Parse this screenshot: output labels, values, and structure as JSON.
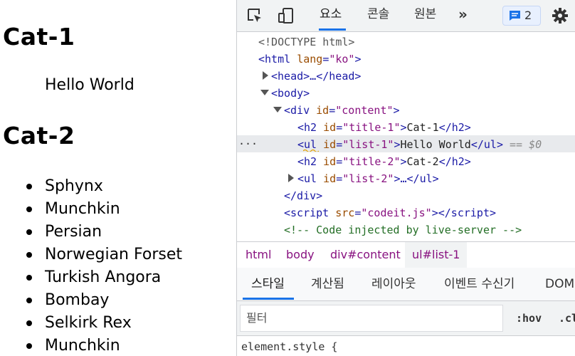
{
  "page": {
    "title1": "Cat-1",
    "hello": "Hello World",
    "title2": "Cat-2",
    "cats": [
      "Sphynx",
      "Munchkin",
      "Persian",
      "Norwegian Forset",
      "Turkish Angora",
      "Bombay",
      "Selkirk Rex",
      "Munchkin"
    ]
  },
  "devtools": {
    "tabs": [
      "요소",
      "콘솔",
      "원본"
    ],
    "more": "»",
    "issues_count": "2",
    "tree": {
      "doctype": "<!DOCTYPE html>",
      "html_open": "<html",
      "html_lang_attr": "lang",
      "html_lang_val": "\"ko\"",
      "head": "<head>…</head>",
      "body": "<body>",
      "div_id": "\"content\"",
      "h2_1_id": "\"title-1\"",
      "h2_1_text": "Cat-1",
      "ul_1_id": "\"list-1\"",
      "ul_1_text": "Hello World",
      "eq": "== $0",
      "h2_2_id": "\"title-2\"",
      "h2_2_text": "Cat-2",
      "ul_2_id": "\"list-2\"",
      "div_close": "</div>",
      "script_src": "\"codeit.js\"",
      "comment": "<!-- Code injected by live-server -->",
      "dots": "···"
    },
    "breadcrumbs": [
      "html",
      "body",
      "div#content",
      "ul#list-1"
    ],
    "subtabs": [
      "스타일",
      "계산됨",
      "레이아웃",
      "이벤트 수신기",
      "DOM"
    ],
    "filter_placeholder": "필터",
    "hov": ":hov",
    "cls": ".cl",
    "element_style": "element.style {"
  },
  "colors": {
    "accent": "#1a73e8",
    "tag": "#881280",
    "attr": "#994500",
    "value": "#1a1aa6",
    "comment": "#236e25"
  }
}
